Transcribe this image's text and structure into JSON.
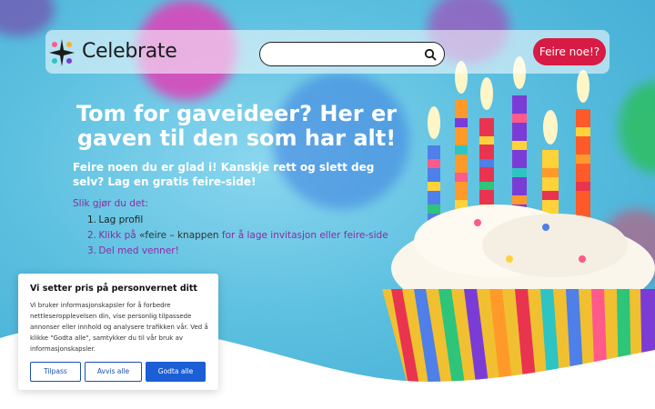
{
  "brand": {
    "name": "Celebrate"
  },
  "search": {
    "placeholder": "",
    "value": "",
    "icon": "search-icon"
  },
  "header": {
    "cta_label": "Feire noe!?"
  },
  "hero": {
    "title": "Tom for gaveideer? Her er gaven til den som har alt!",
    "subtitle": "Feire noen du er glad i! Kanskje rett og slett deg selv? Lag en gratis feire-side!",
    "howto_heading": "Slik gjør du det:",
    "steps": [
      {
        "num": "1.",
        "text": "Lag profil"
      },
      {
        "num": "2.",
        "text_a": "Klikk på ",
        "text_b": "«feire – knappen",
        "text_c": " for å lage invitasjon eller feire-side"
      },
      {
        "num": "3.",
        "text": "Del med venner!"
      }
    ]
  },
  "cookie": {
    "title": "Vi setter pris på personvernet ditt",
    "body": "Vi bruker informasjonskapsler for å forbedre nettleseropplevelsen din, vise personlig tilpassede annonser eller innhold og analysere trafikken vår. Ved å klikke \"Godta alle\", samtykker du til vår bruk av informasjonskapsler.",
    "customize_label": "Tilpass",
    "reject_label": "Avvis alle",
    "accept_label": "Godta alle"
  },
  "colors": {
    "cta": "#d81b44",
    "accent_purple": "#8e2aa6",
    "accept": "#1b5ed6",
    "sky": "#5fc2e0"
  }
}
